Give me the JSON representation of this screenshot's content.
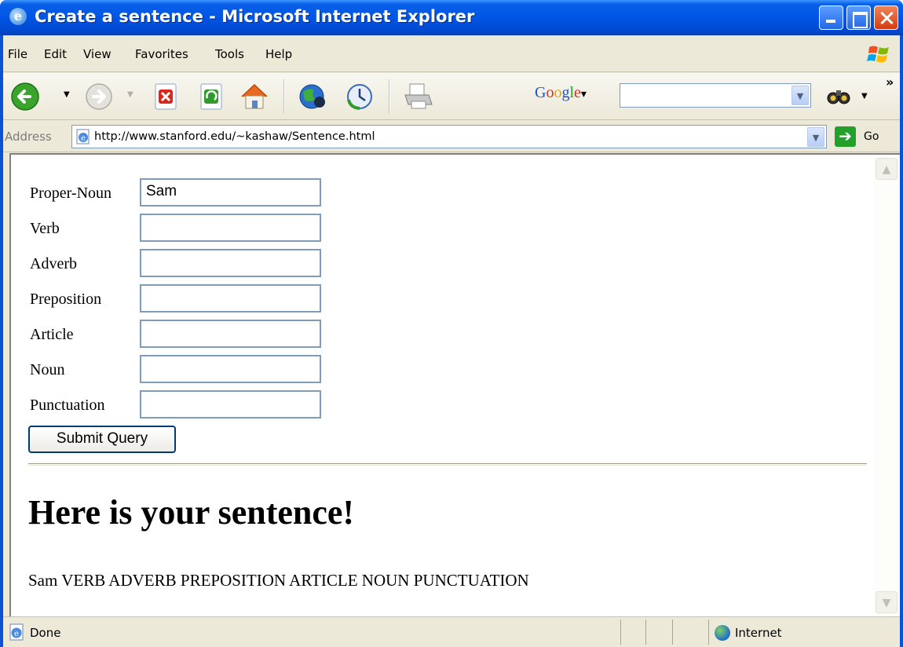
{
  "window": {
    "title": "Create a sentence - Microsoft Internet Explorer"
  },
  "menu": [
    "File",
    "Edit",
    "View",
    "Favorites",
    "Tools",
    "Help"
  ],
  "toolbar": {
    "search_brand": "Google",
    "search_dropdown": "▾",
    "overflow": "»"
  },
  "address": {
    "label": "Address",
    "url": "http://www.stanford.edu/~kashaw/Sentence.html",
    "go_label": "Go"
  },
  "form": {
    "fields": [
      {
        "label": "Proper-Noun",
        "value": "Sam"
      },
      {
        "label": "Verb",
        "value": ""
      },
      {
        "label": "Adverb",
        "value": ""
      },
      {
        "label": "Preposition",
        "value": ""
      },
      {
        "label": "Article",
        "value": ""
      },
      {
        "label": "Noun",
        "value": ""
      },
      {
        "label": "Punctuation",
        "value": ""
      }
    ],
    "submit_label": "Submit Query"
  },
  "result": {
    "heading": "Here is your sentence!",
    "sentence": "Sam VERB ADVERB PREPOSITION ARTICLE NOUN PUNCTUATION"
  },
  "status": {
    "text": "Done",
    "zone": "Internet"
  },
  "colors": {
    "titlebar": "#0055e5",
    "chrome": "#ece9d8",
    "input_border": "#7f9db9",
    "close_button": "#d23c10"
  },
  "icons": [
    "ie-logo-icon",
    "back-icon",
    "forward-icon",
    "stop-icon",
    "refresh-icon",
    "home-icon",
    "media-icon",
    "history-icon",
    "print-icon",
    "binoculars-icon",
    "page-icon",
    "go-arrow-icon",
    "globe-icon"
  ]
}
